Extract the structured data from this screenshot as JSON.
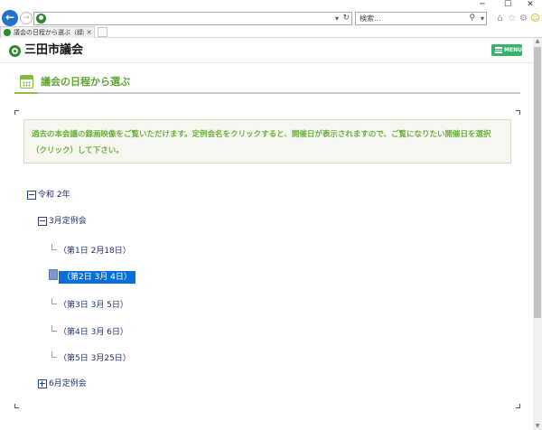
{
  "window": {
    "minimize": "─",
    "maximize": "☐",
    "close": "✕"
  },
  "nav": {
    "back": "←",
    "forward": "→",
    "address_dropdown": "▾",
    "refresh": "↻",
    "search_placeholder": "検索...",
    "search_icon": "⚲",
    "search_dropdown": "▾"
  },
  "toolbar_icons": {
    "home": "⌂",
    "star": "☆",
    "gear": "⚙",
    "smile": "☺"
  },
  "tab": {
    "title": "議会の日程から選ぶ（録画...",
    "close": "×"
  },
  "site": {
    "title": "三田市議会",
    "menu_label": "MENU"
  },
  "section": {
    "title": "議会の日程から選ぶ"
  },
  "notice": {
    "text": "過去の本会議の録画映像をご覧いただけます。定例会名をクリックすると、開催日が表示されますので、ご覧になりたい開催日を選択（クリック）して下さい。"
  },
  "tree": {
    "year": "令和 2年",
    "sessions": [
      {
        "label": "3月定例会",
        "expanded": true,
        "days": [
          {
            "label": "（第1日 2月18日）",
            "selected": false
          },
          {
            "label": "（第2日 3月 4日）",
            "selected": true
          },
          {
            "label": "（第3日 3月 5日）",
            "selected": false
          },
          {
            "label": "（第4日 3月 6日）",
            "selected": false
          },
          {
            "label": "（第5日 3月25日）",
            "selected": false
          }
        ]
      },
      {
        "label": "6月定例会",
        "expanded": false,
        "days": []
      }
    ]
  },
  "colors": {
    "accent_green": "#37b26b",
    "text_green": "#6aae3c",
    "tree_text": "#1f2f77",
    "selection": "#0a6fd4",
    "browser_back": "#1f74c7"
  }
}
